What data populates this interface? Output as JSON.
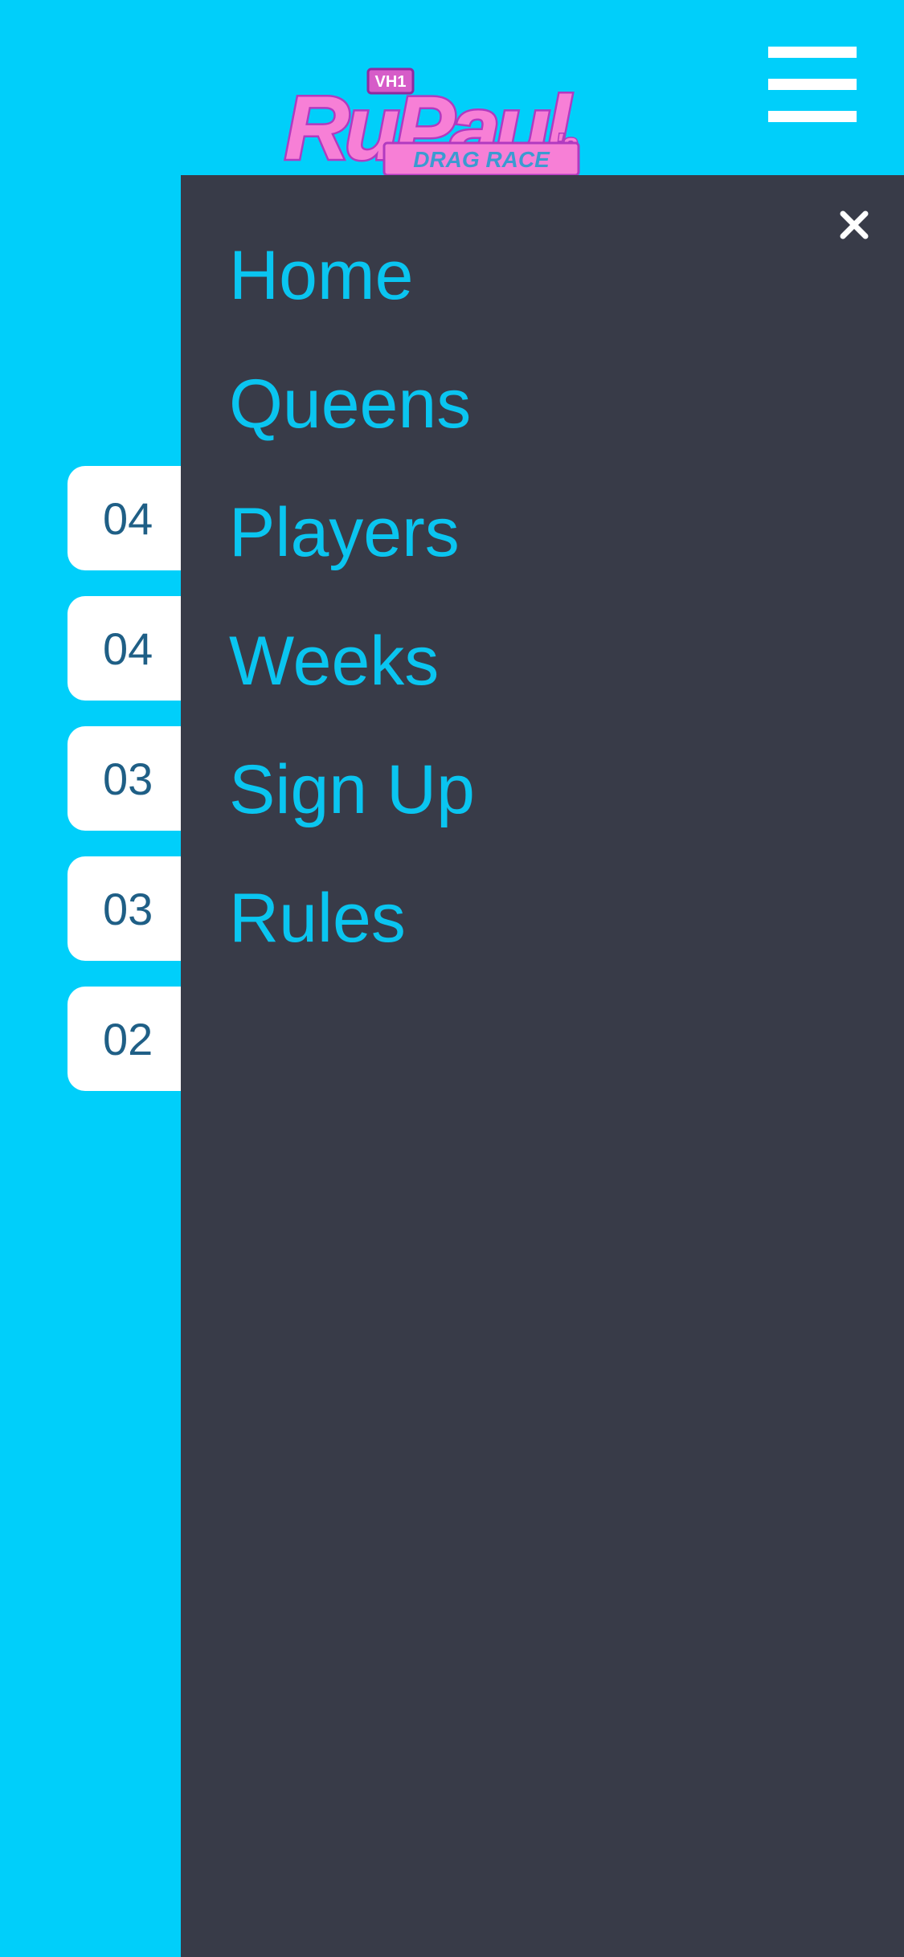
{
  "header": {
    "logo_text": "RuPaul's DRAG RACE",
    "logo_badge": "VH1",
    "menu_icon": "hamburger-menu-icon"
  },
  "scores": [
    {
      "value": "04"
    },
    {
      "value": "04"
    },
    {
      "value": "03"
    },
    {
      "value": "03"
    },
    {
      "value": "02"
    }
  ],
  "drawer": {
    "close_icon": "close-icon",
    "items": [
      {
        "label": "Home"
      },
      {
        "label": "Queens"
      },
      {
        "label": "Players"
      },
      {
        "label": "Weeks"
      },
      {
        "label": "Sign Up"
      },
      {
        "label": "Rules"
      }
    ]
  },
  "colors": {
    "background": "#00cffa",
    "drawer": "#383b48",
    "nav_text": "#0ac5f0",
    "score_text": "#1f5f86",
    "logo_pink": "#f77fd6",
    "logo_outline": "#b13ac0"
  }
}
